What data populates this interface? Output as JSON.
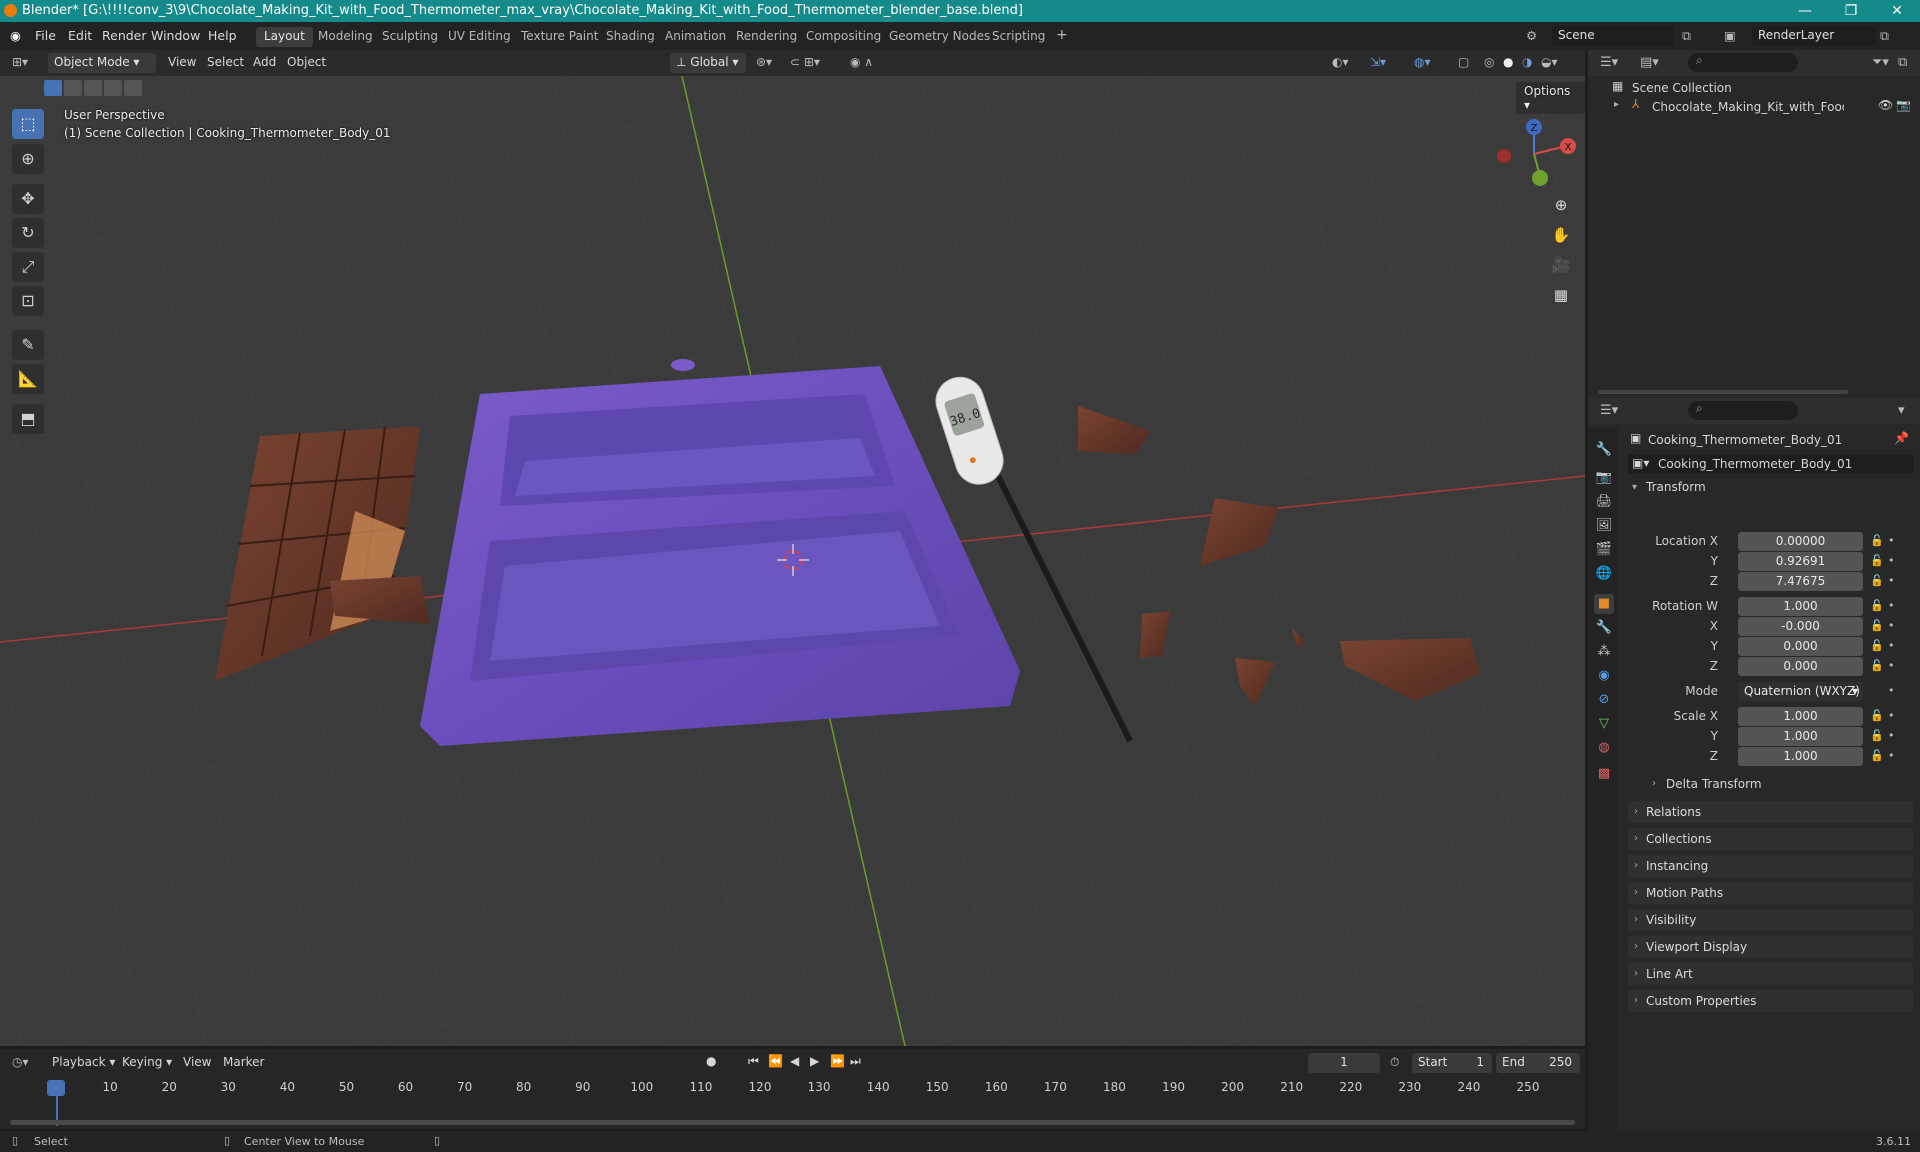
{
  "titlebar": {
    "title": "Blender* [G:\\!!!!conv_3\\9\\Chocolate_Making_Kit_with_Food_Thermometer_max_vray\\Chocolate_Making_Kit_with_Food_Thermometer_blender_base.blend]",
    "minimize": "—",
    "maximize": "❐",
    "close": "✕"
  },
  "menu": [
    "File",
    "Edit",
    "Render",
    "Window",
    "Help"
  ],
  "workspaces": [
    "Layout",
    "Modeling",
    "Sculpting",
    "UV Editing",
    "Texture Paint",
    "Shading",
    "Animation",
    "Rendering",
    "Compositing",
    "Geometry Nodes",
    "Scripting"
  ],
  "workspace_add": "+",
  "scene": {
    "name": "Scene",
    "render_layer": "RenderLayer"
  },
  "viewport_header": {
    "mode": "Object Mode",
    "menus": [
      "View",
      "Select",
      "Add",
      "Object"
    ],
    "orientation": "Global",
    "options": "Options"
  },
  "viewport": {
    "perspective": "User Perspective",
    "collection_info": "(1) Scene Collection | Cooking_Thermometer_Body_01",
    "thermometer_display": "38.0",
    "axis_labels": {
      "z": "Z",
      "x": "X",
      "y": "Y"
    }
  },
  "outliner": {
    "root": "Scene Collection",
    "items": [
      {
        "label": "Chocolate_Making_Kit_with_Food_Therr"
      }
    ]
  },
  "properties": {
    "object_name": "Cooking_Thermometer_Body_01",
    "data_name": "Cooking_Thermometer_Body_01",
    "transform_label": "Transform",
    "location": {
      "label": "Location X",
      "x": "0.00000",
      "y": "0.92691",
      "z": "7.47675"
    },
    "rotation": {
      "label": "Rotation W",
      "w": "1.000",
      "x": "-0.000",
      "y": "0.000",
      "z": "0.000"
    },
    "mode_label": "Mode",
    "mode_value": "Quaternion (WXYZ)",
    "scale": {
      "label": "Scale X",
      "x": "1.000",
      "y": "1.000",
      "z": "1.000"
    },
    "axis_y": "Y",
    "axis_z": "Z",
    "axis_x": "X",
    "delta_transform": "Delta Transform",
    "panels": [
      "Relations",
      "Collections",
      "Instancing",
      "Motion Paths",
      "Visibility",
      "Viewport Display",
      "Line Art",
      "Custom Properties"
    ]
  },
  "timeline": {
    "menus": [
      "Playback",
      "Keying",
      "View",
      "Marker"
    ],
    "current_frame": "1",
    "start_label": "Start",
    "start": "1",
    "end_label": "End",
    "end": "250",
    "frames": [
      "1",
      "10",
      "20",
      "30",
      "40",
      "50",
      "60",
      "70",
      "80",
      "90",
      "100",
      "110",
      "120",
      "130",
      "140",
      "150",
      "160",
      "170",
      "180",
      "190",
      "200",
      "210",
      "220",
      "230",
      "240",
      "250"
    ]
  },
  "statusbar": {
    "select": "Select",
    "center_view": "Center View to Mouse",
    "version": "3.6.11"
  }
}
